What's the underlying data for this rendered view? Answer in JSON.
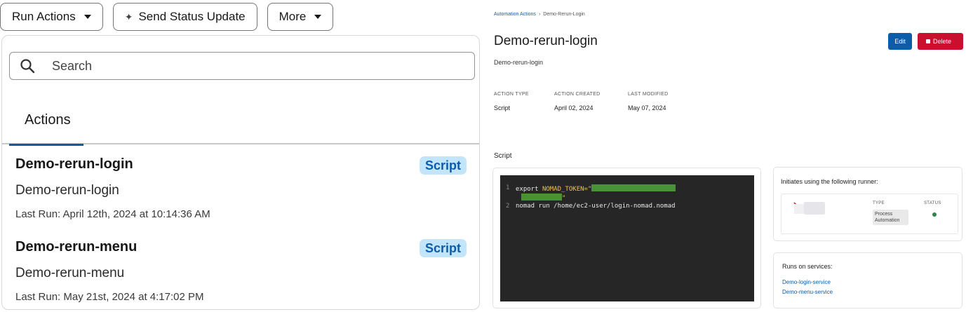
{
  "toolbar": {
    "run_actions_label": "Run Actions",
    "send_status_label": "Send Status Update",
    "more_label": "More"
  },
  "dropdown": {
    "search_placeholder": "Search",
    "tab_label": "Actions",
    "items": [
      {
        "name": "Demo-rerun-login",
        "description": "Demo-rerun-login",
        "badge": "Script",
        "last_run": "Last Run: April 12th, 2024 at 10:14:36 AM"
      },
      {
        "name": "Demo-rerun-menu",
        "description": "Demo-rerun-menu",
        "badge": "Script",
        "last_run": "Last Run: May 21st, 2024 at 4:17:02 PM"
      }
    ]
  },
  "detail": {
    "breadcrumb": {
      "parent": "Automation Actions",
      "separator": "›",
      "current": "Demo-Rerun-Login"
    },
    "title": "Demo-rerun-login",
    "subtitle": "Demo-rerun-login",
    "edit_label": "Edit",
    "delete_label": "Delete",
    "meta": [
      {
        "label": "ACTION TYPE",
        "value": "Script"
      },
      {
        "label": "ACTION CREATED",
        "value": "April 02, 2024"
      },
      {
        "label": "LAST MODIFIED",
        "value": "May 07, 2024"
      }
    ],
    "script_heading": "Script",
    "code": {
      "line1_num": "1",
      "line1_prefix": "export ",
      "line1_var": "NOMAD_TOKEN=\"",
      "line1_cont": "\"",
      "line2_num": "2",
      "line2_text": "nomad run /home/ec2-user/login-nomad.nomad"
    },
    "runner": {
      "title": "Initiates using the following runner:",
      "type_header": "TYPE",
      "status_header": "STATUS",
      "type_value": "Process Automation",
      "status_color": "#2e844a"
    },
    "services": {
      "title": "Runs on services:",
      "links": [
        "Demo-login-service",
        "Demo-menu-service"
      ]
    }
  },
  "colors": {
    "brand_blue": "#0b5cab",
    "delete_red": "#c9102f",
    "badge_bg": "#c3e5fa",
    "code_bg": "#262626"
  }
}
